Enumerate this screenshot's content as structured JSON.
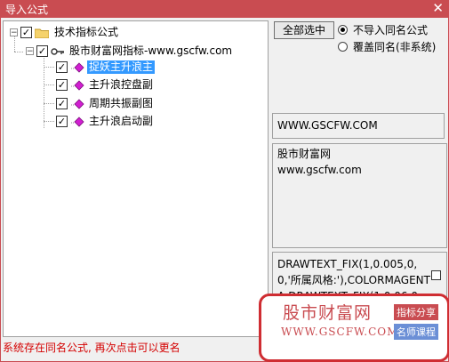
{
  "window": {
    "title": "导入公式",
    "close_glyph": "✕"
  },
  "tree": {
    "root": {
      "label": "技术指标公式",
      "toggle": "−",
      "checked": true
    },
    "group": {
      "label": "股市财富网指标-www.gscfw.com",
      "toggle": "−",
      "checked": true
    },
    "items": [
      {
        "label": "捉妖主升浪主",
        "checked": true,
        "selected": true
      },
      {
        "label": "主升浪控盘副",
        "checked": true,
        "selected": false
      },
      {
        "label": "周期共振副图",
        "checked": true,
        "selected": false
      },
      {
        "label": "主升浪启动副",
        "checked": true,
        "selected": false
      }
    ]
  },
  "controls": {
    "select_all": "全部选中",
    "radio_skip": "不导入同名公式",
    "radio_overwrite": "覆盖同名(非系统)",
    "radio_selected": "skip"
  },
  "details": {
    "url": "WWW.GSCFW.COM",
    "desc_line1": "股市财富网",
    "desc_line2": "www.gscfw.com",
    "code": "DRAWTEXT_FIX(1,0.005,0,0,'所属风格:'),COLORMAGENTA;DRAWTEXT_FIX(1,0.06,0,0,FGBLOCK),COLOR"
  },
  "status": "系统存在同名公式, 再次点击可以更名",
  "ad": {
    "name": "股市财富网",
    "url": "WWW.GSCFW.COM",
    "tag1": "指标分享",
    "tag2": "名师课程"
  },
  "colors": {
    "title_bar": "#c94c51",
    "selection": "#3399ff",
    "status_text": "#d40000",
    "magenta_icon": "#d11fd1"
  }
}
